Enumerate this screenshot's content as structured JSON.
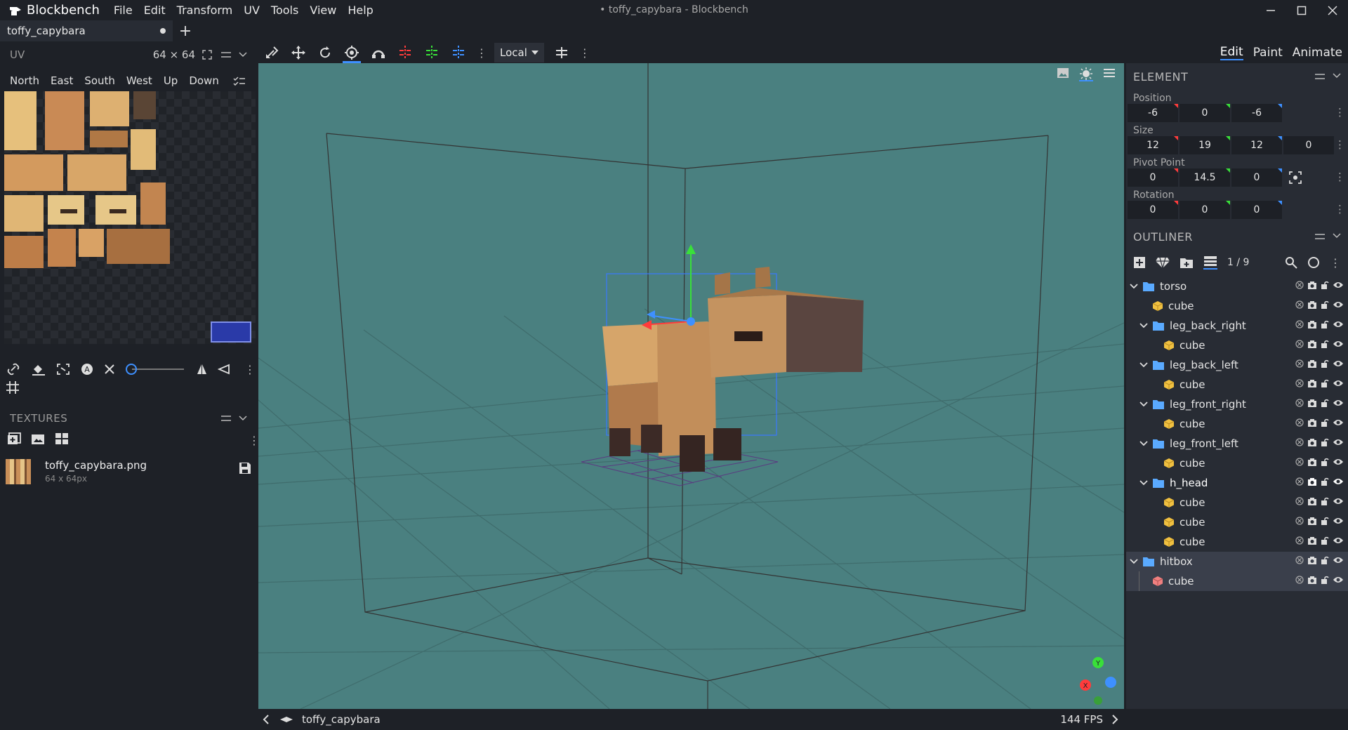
{
  "app": {
    "name": "Blockbench",
    "window_title": "• toffy_capybara - Blockbench",
    "menus": [
      "File",
      "Edit",
      "Transform",
      "UV",
      "Tools",
      "View",
      "Help"
    ]
  },
  "tabs": [
    {
      "label": "toffy_capybara"
    }
  ],
  "uv": {
    "title": "UV",
    "size": "64 × 64",
    "faces": [
      "North",
      "East",
      "South",
      "West",
      "Up",
      "Down"
    ]
  },
  "textures": {
    "title": "TEXTURES",
    "items": [
      {
        "name": "toffy_capybara.png",
        "dims": "64 x 64px"
      }
    ]
  },
  "toolbar": {
    "space": "Local"
  },
  "modes": [
    "Edit",
    "Paint",
    "Animate"
  ],
  "element": {
    "title": "ELEMENT",
    "position": {
      "label": "Position",
      "values": [
        "-6",
        "0",
        "-6"
      ]
    },
    "size": {
      "label": "Size",
      "values": [
        "12",
        "19",
        "12",
        "0"
      ]
    },
    "pivot": {
      "label": "Pivot Point",
      "values": [
        "0",
        "14.5",
        "0"
      ]
    },
    "rotation": {
      "label": "Rotation",
      "values": [
        "0",
        "0",
        "0"
      ]
    }
  },
  "outliner": {
    "title": "OUTLINER",
    "counter": "1 / 9",
    "nodes": [
      {
        "label": "torso",
        "type": "group",
        "depth": 0
      },
      {
        "label": "cube",
        "type": "cube",
        "depth": 1
      },
      {
        "label": "leg_back_right",
        "type": "group",
        "depth": 1
      },
      {
        "label": "cube",
        "type": "cube",
        "depth": 2
      },
      {
        "label": "leg_back_left",
        "type": "group",
        "depth": 1
      },
      {
        "label": "cube",
        "type": "cube",
        "depth": 2
      },
      {
        "label": "leg_front_right",
        "type": "group",
        "depth": 1
      },
      {
        "label": "cube",
        "type": "cube",
        "depth": 2
      },
      {
        "label": "leg_front_left",
        "type": "group",
        "depth": 1
      },
      {
        "label": "cube",
        "type": "cube",
        "depth": 2
      },
      {
        "label": "h_head",
        "type": "group",
        "depth": 1
      },
      {
        "label": "cube",
        "type": "cube",
        "depth": 2
      },
      {
        "label": "cube",
        "type": "cube",
        "depth": 2
      },
      {
        "label": "cube",
        "type": "cube",
        "depth": 2
      },
      {
        "label": "hitbox",
        "type": "group",
        "depth": 0
      },
      {
        "label": "cube",
        "type": "cube-selected",
        "depth": 1
      }
    ]
  },
  "status": {
    "model": "toffy_capybara",
    "fps": "144 FPS"
  },
  "gizmo": {
    "y": "Y",
    "x": "X"
  },
  "colors": {
    "accent": "#3e90ff",
    "viewport": "#4a8080",
    "x_axis": "#ff3b3b",
    "y_axis": "#39e039",
    "z_axis": "#3e90ff",
    "cube": "#f0c040",
    "selected_cube": "#f08080"
  }
}
